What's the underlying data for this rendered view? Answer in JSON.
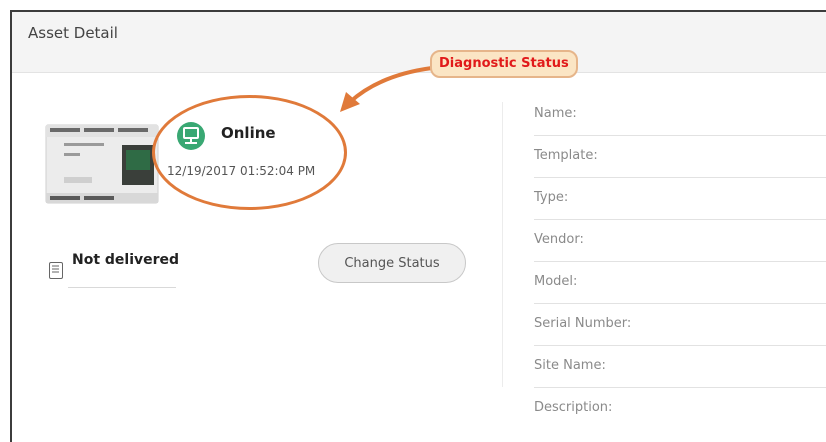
{
  "header": {
    "title": "Asset Detail"
  },
  "annotation": {
    "label": "Diagnostic Status"
  },
  "status": {
    "text": "Online",
    "timestamp": "12/19/2017 01:52:04 PM",
    "color": "#39a873",
    "icon": "network-device-icon"
  },
  "delivery": {
    "text": "Not delivered",
    "icon": "document-list-icon"
  },
  "actions": {
    "change_status_label": "Change Status"
  },
  "fields": [
    {
      "label": "Name:"
    },
    {
      "label": "Template:"
    },
    {
      "label": "Type:"
    },
    {
      "label": "Vendor:"
    },
    {
      "label": "Model:"
    },
    {
      "label": "Serial Number:"
    },
    {
      "label": "Site Name:"
    },
    {
      "label": "Description:"
    }
  ],
  "colors": {
    "annotation": "#e07a3a",
    "annotation_text": "#e11a1a"
  }
}
